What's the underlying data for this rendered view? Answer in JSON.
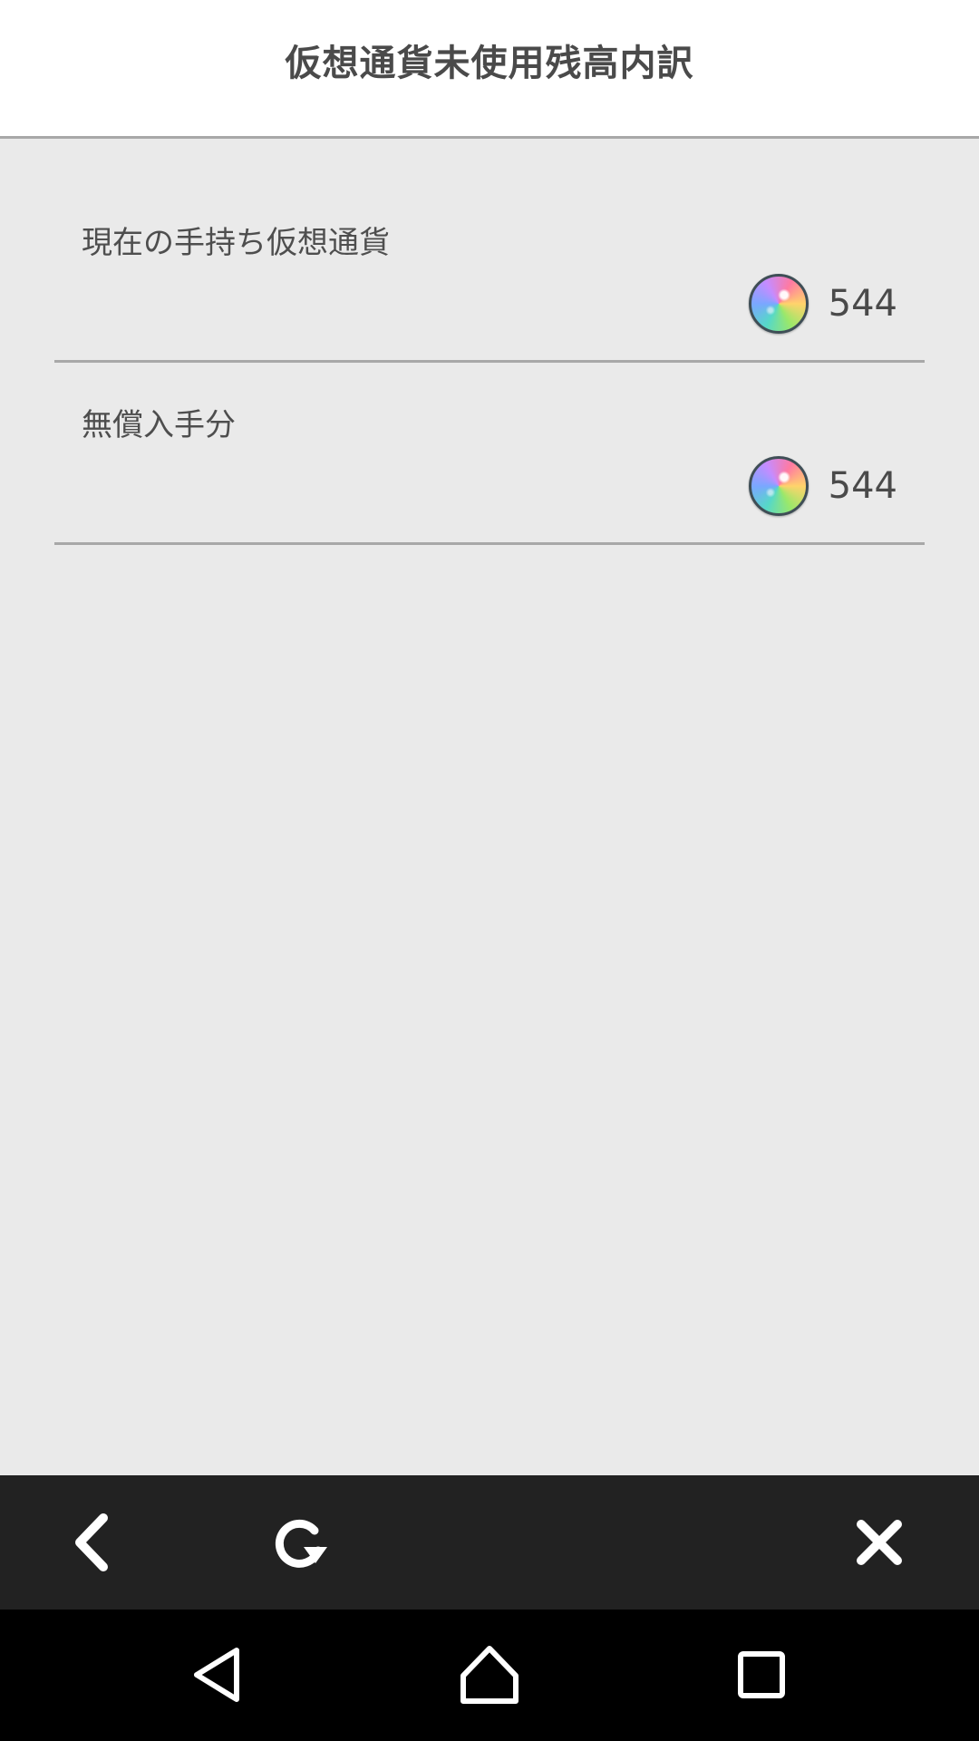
{
  "header": {
    "title": "仮想通貨未使用残高内訳"
  },
  "rows": [
    {
      "label": "現在の手持ち仮想通貨",
      "icon": "rainbow-gem-icon",
      "value": "544"
    },
    {
      "label": "無償入手分",
      "icon": "rainbow-gem-icon",
      "value": "544"
    }
  ],
  "toolbar": {
    "back_icon": "chevron-left-icon",
    "reload_icon": "reload-icon",
    "close_icon": "close-icon"
  },
  "navbar": {
    "back_icon": "nav-back-triangle-icon",
    "home_icon": "nav-home-icon",
    "recents_icon": "nav-recents-square-icon"
  },
  "colors": {
    "background": "#eaeaea",
    "header_bg": "#ffffff",
    "toolbar_bg": "#222222",
    "navbar_bg": "#000000",
    "text": "#4a4a4a"
  }
}
